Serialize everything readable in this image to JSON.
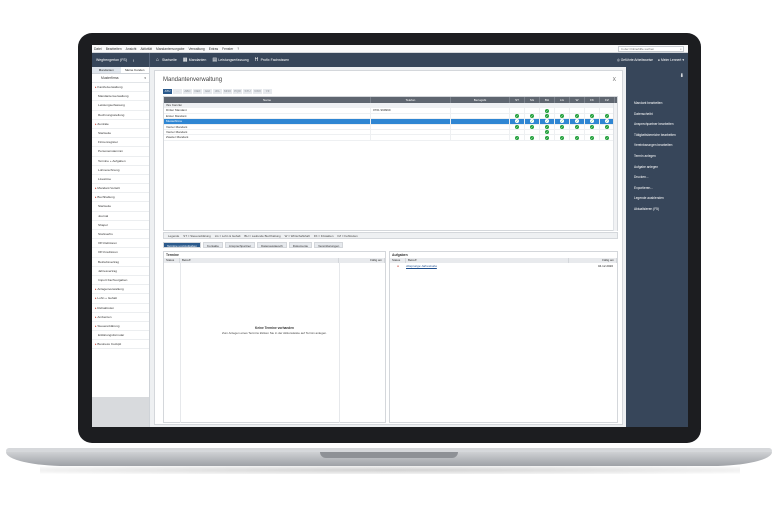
{
  "menu": [
    "Datei",
    "Bearbeiten",
    "Ansicht",
    "Aktivität",
    "Mandantenvorgabe",
    "Verwaltung",
    "Extras",
    "Fenster",
    "?"
  ],
  "search_placeholder": "In der Onlinehilfe suchen",
  "toolbar": {
    "context": "Wegfrengerton (FS)",
    "start": "Startseite",
    "mandanten": "Mandanten",
    "leistung": "Leistungserfassung",
    "profix": "Profix Fachwissen",
    "gefuehrt": "Geführte Arbeitsweise",
    "user": "Meier Lennert"
  },
  "sidebar": {
    "tabs": [
      "Mandanten",
      "Meine Kunden"
    ],
    "search_value": "Musterfirma",
    "items": [
      {
        "label": "Kanzleiverwaltung",
        "kind": "grp"
      },
      {
        "label": "Mandantenverwaltung",
        "kind": "sub"
      },
      {
        "label": "Leistungserfassung",
        "kind": "sub"
      },
      {
        "label": "Rechnungsstellung",
        "kind": "sub"
      },
      {
        "label": "Zentrale",
        "kind": "grp"
      },
      {
        "label": "Startseite",
        "kind": "sub"
      },
      {
        "label": "Firmenregister",
        "kind": "sub"
      },
      {
        "label": "Personenstammm",
        "kind": "sub"
      },
      {
        "label": "Termine + Aufgaben",
        "kind": "sub"
      },
      {
        "label": "Lohnerechnung",
        "kind": "sub"
      },
      {
        "label": "Livestime",
        "kind": "sub"
      },
      {
        "label": "Mandant Verteilt",
        "kind": "grp"
      },
      {
        "label": "Buchhaltung",
        "kind": "grp"
      },
      {
        "label": "Startseite",
        "kind": "sub"
      },
      {
        "label": "Journal",
        "kind": "sub"
      },
      {
        "label": "Shapol",
        "kind": "sub"
      },
      {
        "label": "Storkserbs",
        "kind": "sub"
      },
      {
        "label": "OP-Debitoren",
        "kind": "sub"
      },
      {
        "label": "OP-Kreditoren",
        "kind": "sub"
      },
      {
        "label": "Betriebsvertrag",
        "kind": "sub"
      },
      {
        "label": "Jahresvertrag",
        "kind": "sub"
      },
      {
        "label": "Import Fachvorgaben",
        "kind": "sub"
      },
      {
        "label": "Anlagenverwaltung",
        "kind": "grp"
      },
      {
        "label": "Lohn + Gehalt",
        "kind": "grp"
      },
      {
        "label": "Rehaktrolen",
        "kind": "grp"
      },
      {
        "label": "Ambenten",
        "kind": "grp"
      },
      {
        "label": "Steuererklärung",
        "kind": "grp"
      },
      {
        "label": "Erklärungsformular",
        "kind": "sub"
      },
      {
        "label": "Business Cockpit",
        "kind": "grp"
      }
    ]
  },
  "main": {
    "title": "Mandantenverwaltung",
    "close": "X",
    "alpha_tabs": [
      "ATU",
      "...",
      "ABC",
      "DEF",
      "GHI",
      "JKL",
      "MNO",
      "PQR",
      "STU",
      "VWX",
      "YZ"
    ],
    "columns": [
      "Name",
      "Telefon",
      "Bezugsbt",
      "ST",
      "SG",
      "BH",
      "LG",
      "W",
      "FK",
      "FZ"
    ],
    "rows": [
      {
        "name": "Ihre Kanzlei",
        "tel": "",
        "marks": [
          0,
          0,
          0,
          0,
          0,
          0,
          0
        ],
        "filter": true
      },
      {
        "name": "Dritter Mandant",
        "tel": "0761 999999",
        "marks": [
          0,
          0,
          1,
          0,
          0,
          0,
          0
        ]
      },
      {
        "name": "Erster Mandant",
        "tel": "",
        "marks": [
          1,
          1,
          1,
          1,
          1,
          1,
          1
        ]
      },
      {
        "name": "Musterfirma",
        "tel": "",
        "marks": [
          1,
          1,
          1,
          1,
          1,
          1,
          1
        ],
        "selected": true
      },
      {
        "name": "Vierter Mandant",
        "tel": "",
        "marks": [
          1,
          1,
          1,
          1,
          1,
          1,
          1
        ]
      },
      {
        "name": "Vierter Mandant",
        "tel": "",
        "marks": [
          0,
          0,
          1,
          0,
          0,
          0,
          0
        ]
      },
      {
        "name": "Zweiter Mandant",
        "tel": "",
        "marks": [
          1,
          1,
          1,
          1,
          1,
          1,
          1
        ]
      }
    ],
    "legend": [
      "Legende",
      "ST = Steuererklärung",
      "LG = Lohn & Gehalt",
      "BH = Laufende Buchhaltung",
      "W = Wirtschaftshaft",
      "FK = Fristakten",
      "FZ = Fehlzeiten"
    ],
    "bottom_tabs": [
      "Termine und Aufgaben",
      "Kontakte",
      "Ansprechpartner",
      "Datenaustausch",
      "Dokumente",
      "Vereinbarungen"
    ],
    "termine": {
      "title": "Termine",
      "headers": [
        "Status",
        "Betreff",
        "Fällig am"
      ],
      "empty_title": "Keine Termine vorhanden",
      "empty_text": "Zum Anlegen eines Termins klicken Sie in der Aktionsleiste auf Termin anlegen."
    },
    "aufgaben": {
      "title": "Aufgaben",
      "headers": [
        "Status",
        "Betreff",
        "Fällig am"
      ],
      "rows": [
        {
          "status": "●",
          "betreff": "Absprunge Jahreskuba",
          "faellig": "04.12.2020"
        }
      ]
    }
  },
  "actions": {
    "items": [
      "Mandant bearbeiten",
      "Datenscheibt",
      "Ansprechpartner bearbeiten",
      "Tätigkeitsbereiche bearbeiten",
      "Vereinbarungen bearbeiten",
      "Termin anlegen",
      "Aufgabe anlegen",
      "Drucken...",
      "Exportieren...",
      "Legende ausblenden",
      "Aktualisieren (F5)"
    ]
  },
  "colors": {
    "accent": "#2b5a8c",
    "dark": "#37465a",
    "selected": "#2f86d3",
    "ok": "#25a23e"
  }
}
